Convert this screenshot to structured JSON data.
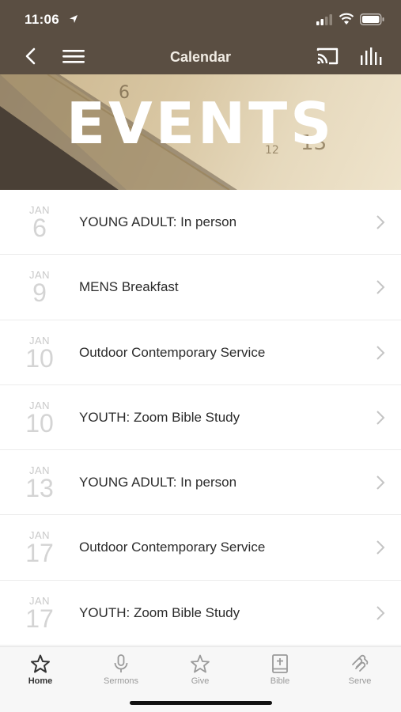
{
  "status_bar": {
    "time": "11:06"
  },
  "nav": {
    "title": "Calendar"
  },
  "banner": {
    "title": "EVENTS"
  },
  "events": [
    {
      "month": "JAN",
      "day": "6",
      "name": "YOUNG ADULT: In person"
    },
    {
      "month": "JAN",
      "day": "9",
      "name": "MENS Breakfast"
    },
    {
      "month": "JAN",
      "day": "10",
      "name": "Outdoor Contemporary Service"
    },
    {
      "month": "JAN",
      "day": "10",
      "name": "YOUTH: Zoom Bible Study"
    },
    {
      "month": "JAN",
      "day": "13",
      "name": "YOUNG ADULT: In person"
    },
    {
      "month": "JAN",
      "day": "17",
      "name": "Outdoor Contemporary Service"
    },
    {
      "month": "JAN",
      "day": "17",
      "name": "YOUTH: Zoom Bible Study"
    }
  ],
  "tabs": [
    {
      "label": "Home",
      "icon": "star-icon",
      "active": true
    },
    {
      "label": "Sermons",
      "icon": "microphone-icon",
      "active": false
    },
    {
      "label": "Give",
      "icon": "star-outline-icon",
      "active": false
    },
    {
      "label": "Bible",
      "icon": "bible-icon",
      "active": false
    },
    {
      "label": "Serve",
      "icon": "serve-icon",
      "active": false
    }
  ],
  "colors": {
    "header_bg": "#5a4e42",
    "banner_tone": "#d8c6a2",
    "accent_text": "#2b2b2b",
    "muted": "#9a9a9a"
  }
}
